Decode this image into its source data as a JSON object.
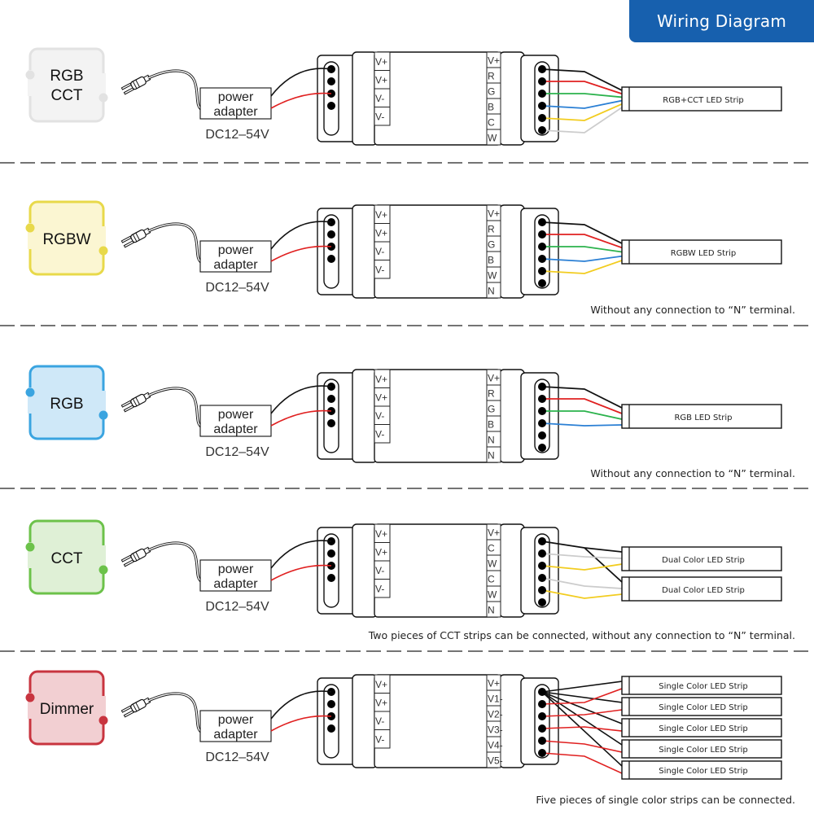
{
  "header": {
    "title": "Wiring Diagram",
    "color": "#1760ae"
  },
  "common": {
    "adapter_label_line1": "power",
    "adapter_label_line2": "adapter",
    "voltage": "DC12–54V",
    "input_terminals": [
      "V+",
      "V+",
      "V-",
      "V-"
    ],
    "wire_colors": {
      "black": "#111111",
      "red": "#e02020",
      "green": "#2bb24c",
      "blue": "#2a7fd4",
      "yellow": "#f2cc1f",
      "white": "#cccccc"
    }
  },
  "sections": [
    {
      "mode": [
        "RGB",
        "CCT"
      ],
      "mode_fill": "#f3f3f3",
      "mode_stroke": "#e2e2e2",
      "output_terminals": [
        "V+",
        "R",
        "G",
        "B",
        "C",
        "W"
      ],
      "wires": [
        "black",
        "red",
        "green",
        "blue",
        "yellow",
        "white"
      ],
      "strips": [
        "RGB+CCT LED Strip"
      ],
      "note": ""
    },
    {
      "mode": [
        "RGBW"
      ],
      "mode_fill": "#fbf6d2",
      "mode_stroke": "#e8d94a",
      "output_terminals": [
        "V+",
        "R",
        "G",
        "B",
        "W",
        "N"
      ],
      "wires": [
        "black",
        "red",
        "green",
        "blue",
        "yellow"
      ],
      "strips": [
        "RGBW LED Strip"
      ],
      "note": "Without any connection to “N” terminal."
    },
    {
      "mode": [
        "RGB"
      ],
      "mode_fill": "#cfe8f8",
      "mode_stroke": "#3aa4e0",
      "output_terminals": [
        "V+",
        "R",
        "G",
        "B",
        "N",
        "N"
      ],
      "wires": [
        "black",
        "red",
        "green",
        "blue"
      ],
      "strips": [
        "RGB LED Strip"
      ],
      "note": "Without any connection to “N” terminal."
    },
    {
      "mode": [
        "CCT"
      ],
      "mode_fill": "#dff0d6",
      "mode_stroke": "#6cc24a",
      "output_terminals": [
        "V+",
        "C",
        "W",
        "C",
        "W",
        "N"
      ],
      "wires": [
        "black",
        "white",
        "yellow",
        "white",
        "yellow"
      ],
      "strips": [
        "Dual Color LED Strip",
        "Dual Color LED Strip"
      ],
      "note": "Two pieces of CCT strips can be connected, without any connection to “N” terminal."
    },
    {
      "mode": [
        "Dimmer"
      ],
      "mode_fill": "#f2cfd2",
      "mode_stroke": "#c8343f",
      "output_terminals": [
        "V+",
        "V1-",
        "V2-",
        "V3-",
        "V4-",
        "V5-"
      ],
      "wires": [
        "black",
        "red",
        "red",
        "red",
        "red",
        "red"
      ],
      "strips": [
        "Single Color LED Strip",
        "Single Color LED Strip",
        "Single Color LED Strip",
        "Single Color LED Strip",
        "Single Color LED Strip"
      ],
      "note": "Five pieces of single color strips can be connected."
    }
  ]
}
